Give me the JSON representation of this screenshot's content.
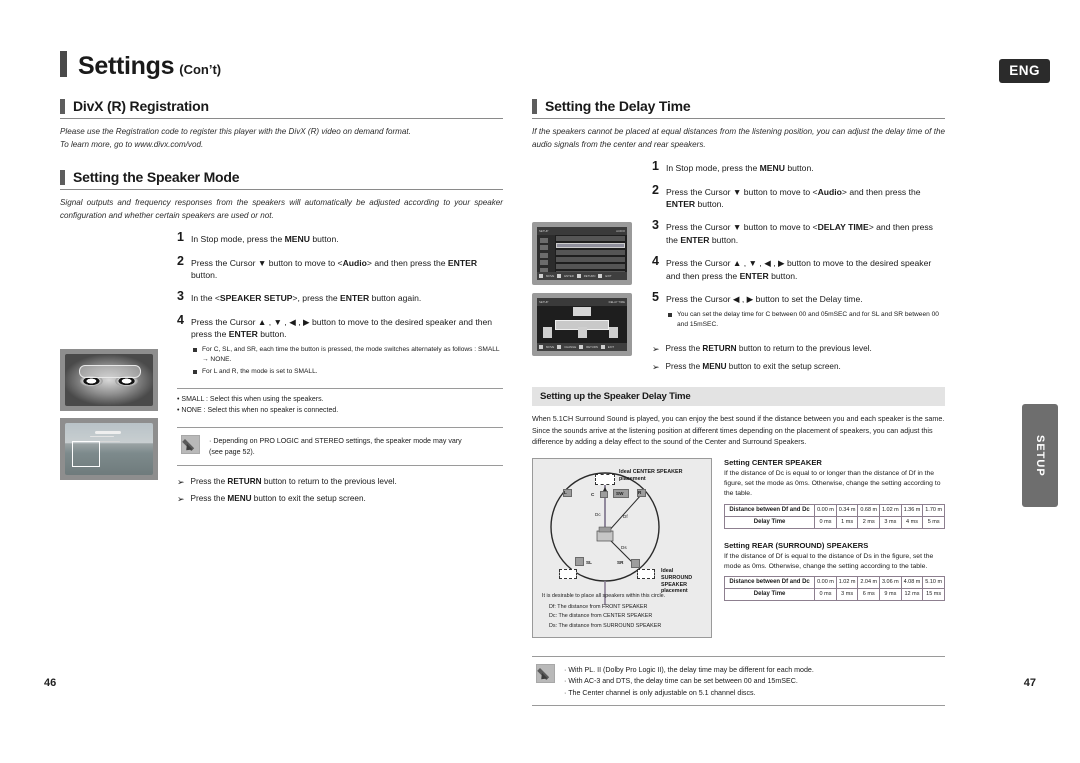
{
  "header": {
    "title_main": "Settings",
    "title_sub": "(Con’t)",
    "language_badge": "ENG"
  },
  "left_column": {
    "section_divx": {
      "heading": "DivX (R) Registration",
      "lead": "Please use the Registration code to register this player with the DivX (R) video on demand format.\nTo learn more, go to www.divx.com/vod."
    },
    "section_speaker_mode": {
      "heading": "Setting the Speaker Mode",
      "lead": "Signal outputs and frequency responses from the speakers will automatically be adjusted according to your speaker configuration and whether certain speakers are used or not.",
      "steps": [
        {
          "num": "1",
          "text": "In Stop mode, press the MENU button."
        },
        {
          "num": "2",
          "text": "Press the Cursor ▼ button to move to <Audio> and then press the ENTER button."
        },
        {
          "num": "3",
          "text": "In the <SPEAKER SETUP>, press the ENTER button again."
        },
        {
          "num": "4",
          "text": "Press the Cursor ▲ , ▼ , ◀ , ▶ button to move to the desired speaker and then press the ENTER button."
        }
      ],
      "sub_items": [
        "For C, SL, and SR, each time the button is pressed, the mode switches alternately as follows : SMALL → NONE.",
        "For L and R, the mode is set to SMALL."
      ],
      "dash_items": [
        "• SMALL : Select this when using the speakers.",
        "• NONE : Select this when no speaker is connected."
      ],
      "note_lines": [
        "· Depending on PRO LOGIC and STEREO settings, the speaker mode may vary",
        "(see page 52)."
      ],
      "arrow_notes": [
        "Press the RETURN button to return to the previous level.",
        "Press the MENU button to exit the setup screen."
      ]
    }
  },
  "right_column": {
    "section_delay": {
      "heading": "Setting the Delay Time",
      "lead": "If the speakers cannot be placed at equal distances from the listening position, you can adjust the delay time of the audio signals from the center and rear speakers.",
      "steps": [
        {
          "num": "1",
          "text": "In Stop mode, press the MENU button."
        },
        {
          "num": "2",
          "text": "Press the Cursor ▼ button to move to <Audio> and then press the ENTER button."
        },
        {
          "num": "3",
          "text": "Press the Cursor ▼ button to move to <DELAY TIME> and then press the ENTER button."
        },
        {
          "num": "4",
          "text": "Press the Cursor ▲ , ▼ , ◀ , ▶ button to move to the desired speaker and then press the ENTER button."
        },
        {
          "num": "5",
          "text": "Press the Cursor ◀ , ▶ button to set the Delay time."
        }
      ],
      "sub_items": [
        "You can set the delay time for C between 00 and 05mSEC and for SL and SR between 00 and 15mSEC."
      ],
      "arrow_notes": [
        "Press the RETURN button to return to the previous level.",
        "Press the MENU button to exit the setup screen."
      ]
    },
    "speaker_delay": {
      "bar_title": "Setting up the Speaker Delay Time",
      "body": "When 5.1CH Surround Sound is played, you can enjoy the best sound if the distance between you and each speaker is the same.\nSince the sounds arrive at the listening position at different times depending on the placement of speakers, you can adjust this difference by adding a delay effect to the sound of the Center and Surround Speakers.",
      "diagram": {
        "label_center": "Ideal CENTER SPEAKER\nplacement",
        "label_surround": "Ideal\nSURROUND\nSPEAKER\nplacement",
        "speakers": [
          "L",
          "R",
          "C",
          "SW",
          "SL",
          "SR"
        ],
        "distances": [
          "Dc",
          "Df",
          "Ds"
        ],
        "caption_first": "It is desirable to place all speakers within this circle.",
        "caption_lines": [
          "Df: The distance from FRONT SPEAKER",
          "Dc: The distance from CENTER SPEAKER",
          "Ds: The distance from SURROUND SPEAKER"
        ]
      },
      "center_table": {
        "title": "Setting CENTER SPEAKER",
        "desc": "If the distance of Dc is equal to or longer than the distance of Df in the figure, set the mode as 0ms. Otherwise, change the setting according to the table.",
        "row1_label": "Distance between Df and Dc",
        "row1_values": [
          "0.00 m",
          "0.34 m",
          "0.68 m",
          "1.02 m",
          "1.36 m",
          "1.70 m"
        ],
        "row2_label": "Delay Time",
        "row2_values": [
          "0 ms",
          "1 ms",
          "2 ms",
          "3 ms",
          "4 ms",
          "5 ms"
        ]
      },
      "rear_table": {
        "title": "Setting REAR (SURROUND) SPEAKERS",
        "desc": "If the distance of Df is equal to the distance of Ds in the figure, set the mode as 0ms. Otherwise, change the setting according to the table.",
        "row1_label": "Distance between Df and Dc",
        "row1_values": [
          "0.00 m",
          "1.02 m",
          "2.04 m",
          "3.06 m",
          "4.08 m",
          "5.10 m"
        ],
        "row2_label": "Delay Time",
        "row2_values": [
          "0 ms",
          "3 ms",
          "6 ms",
          "9 ms",
          "12 ms",
          "15 ms"
        ]
      },
      "note_lines": [
        "· With  PL. II  (Dolby Pro Logic II), the delay time may be different for each mode.",
        "· With AC-3 and DTS, the delay time can be set between 00 and 15mSEC.",
        "· The Center channel is only adjustable on 5.1 channel discs."
      ]
    }
  },
  "side_tab": {
    "label": "SETUP"
  },
  "footer": {
    "page_left": "46",
    "page_right": "47"
  }
}
